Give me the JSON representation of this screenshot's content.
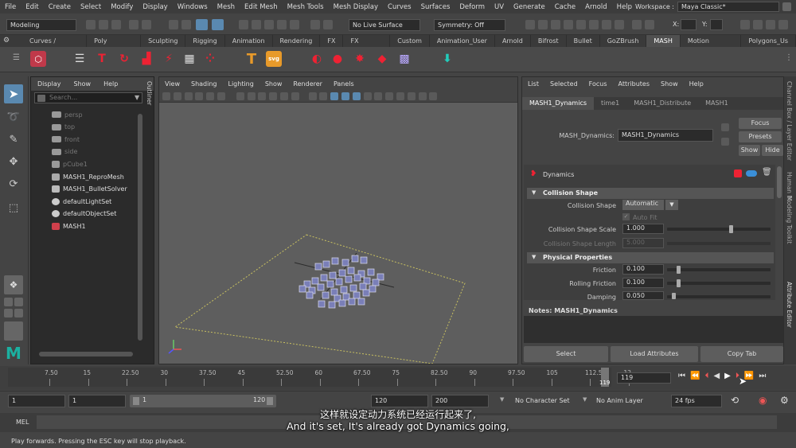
{
  "menubar": {
    "items": [
      "File",
      "Edit",
      "Create",
      "Select",
      "Modify",
      "Display",
      "Windows",
      "Mesh",
      "Edit Mesh",
      "Mesh Tools",
      "Mesh Display",
      "Curves",
      "Surfaces",
      "Deform",
      "UV",
      "Generate",
      "Cache",
      "Arnold",
      "Help"
    ],
    "workspace_label": "Workspace :",
    "workspace_value": "Maya Classic*"
  },
  "statusline": {
    "mode": "Modeling",
    "live_surface": "No Live Surface",
    "symmetry": "Symmetry: Off",
    "x_label": "X:",
    "y_label": "Y:"
  },
  "shelf_tabs": [
    "Curves / Surfaces",
    "Poly Modeling",
    "Sculpting",
    "Rigging",
    "Animation",
    "Rendering",
    "FX",
    "FX Caching",
    "Custom",
    "Animation_User",
    "Arnold",
    "Bifrost",
    "Bullet",
    "GoZBrush",
    "MASH",
    "Motion Graphics",
    "Polygons_Us"
  ],
  "shelf_active": "MASH",
  "shelf_icons": {
    "type_tool": "T",
    "svg_tool": "svg"
  },
  "outliner": {
    "menu": [
      "Display",
      "Show",
      "Help"
    ],
    "search_placeholder": "Search...",
    "tab_label": "Outliner",
    "items": [
      {
        "label": "persp",
        "dim": true
      },
      {
        "label": "top",
        "dim": true
      },
      {
        "label": "front",
        "dim": true
      },
      {
        "label": "side",
        "dim": true
      },
      {
        "label": "pCube1",
        "dim": true
      },
      {
        "label": "MASH1_ReproMesh",
        "dim": false
      },
      {
        "label": "MASH1_BulletSolver",
        "dim": false
      },
      {
        "label": "defaultLightSet",
        "dim": false
      },
      {
        "label": "defaultObjectSet",
        "dim": false
      },
      {
        "label": "MASH1",
        "dim": false
      }
    ]
  },
  "viewport": {
    "menu": [
      "View",
      "Shading",
      "Lighting",
      "Show",
      "Renderer",
      "Panels"
    ]
  },
  "attribute_editor": {
    "menu": [
      "List",
      "Selected",
      "Focus",
      "Attributes",
      "Show",
      "Help"
    ],
    "tabs": [
      "MASH1_Dynamics",
      "time1",
      "MASH1_Distribute",
      "MASH1"
    ],
    "node_label": "MASH_Dynamics:",
    "node_value": "MASH1_Dynamics",
    "focus_btn": "Focus",
    "presets_btn": "Presets",
    "show_btn": "Show",
    "hide_btn": "Hide",
    "panel_title": "Dynamics",
    "collision_section": "Collision Shape",
    "collision_shape_label": "Collision Shape",
    "collision_shape_value": "Automatic",
    "auto_fit_label": "Auto Fit",
    "shape_scale_label": "Collision Shape Scale",
    "shape_scale_value": "1.000",
    "shape_scale_fraction": 0.6,
    "shape_length_label": "Collision Shape Length",
    "shape_length_value": "5.000",
    "physical_section": "Physical Properties",
    "friction_label": "Friction",
    "friction_value": "0.100",
    "rolling_label": "Rolling Friction",
    "rolling_value": "0.100",
    "damping_label": "Damping",
    "damping_value": "0.050",
    "notes_label": "Notes:  MASH1_Dynamics",
    "select_btn": "Select",
    "load_btn": "Load Attributes",
    "copy_btn": "Copy Tab"
  },
  "side_tabs": [
    "Channel Box / Layer Editor",
    "Modeling Toolkit",
    "Human IK",
    "Attribute Editor"
  ],
  "timeline": {
    "ticks": [
      "7.50",
      "15",
      "22.50",
      "30",
      "37.50",
      "45",
      "52.50",
      "60",
      "67.50",
      "75",
      "82.50",
      "90",
      "97.50",
      "105",
      "112.50",
      "12"
    ],
    "playhead_label": "119",
    "current_frame": "119"
  },
  "range": {
    "start": "1",
    "anim_start": "1",
    "slider_start": "1",
    "slider_end": "120",
    "range_end": "120",
    "anim_end": "200",
    "character_set": "No Character Set",
    "anim_layer": "No Anim Layer",
    "fps": "24 fps"
  },
  "mel_label": "MEL",
  "help_line": "Play forwards. Pressing the ESC key will stop playback.",
  "subtitle_cn": "这样就设定动力系统已经运行起来了,",
  "subtitle_en": "And it's set, It's already got Dynamics going,"
}
